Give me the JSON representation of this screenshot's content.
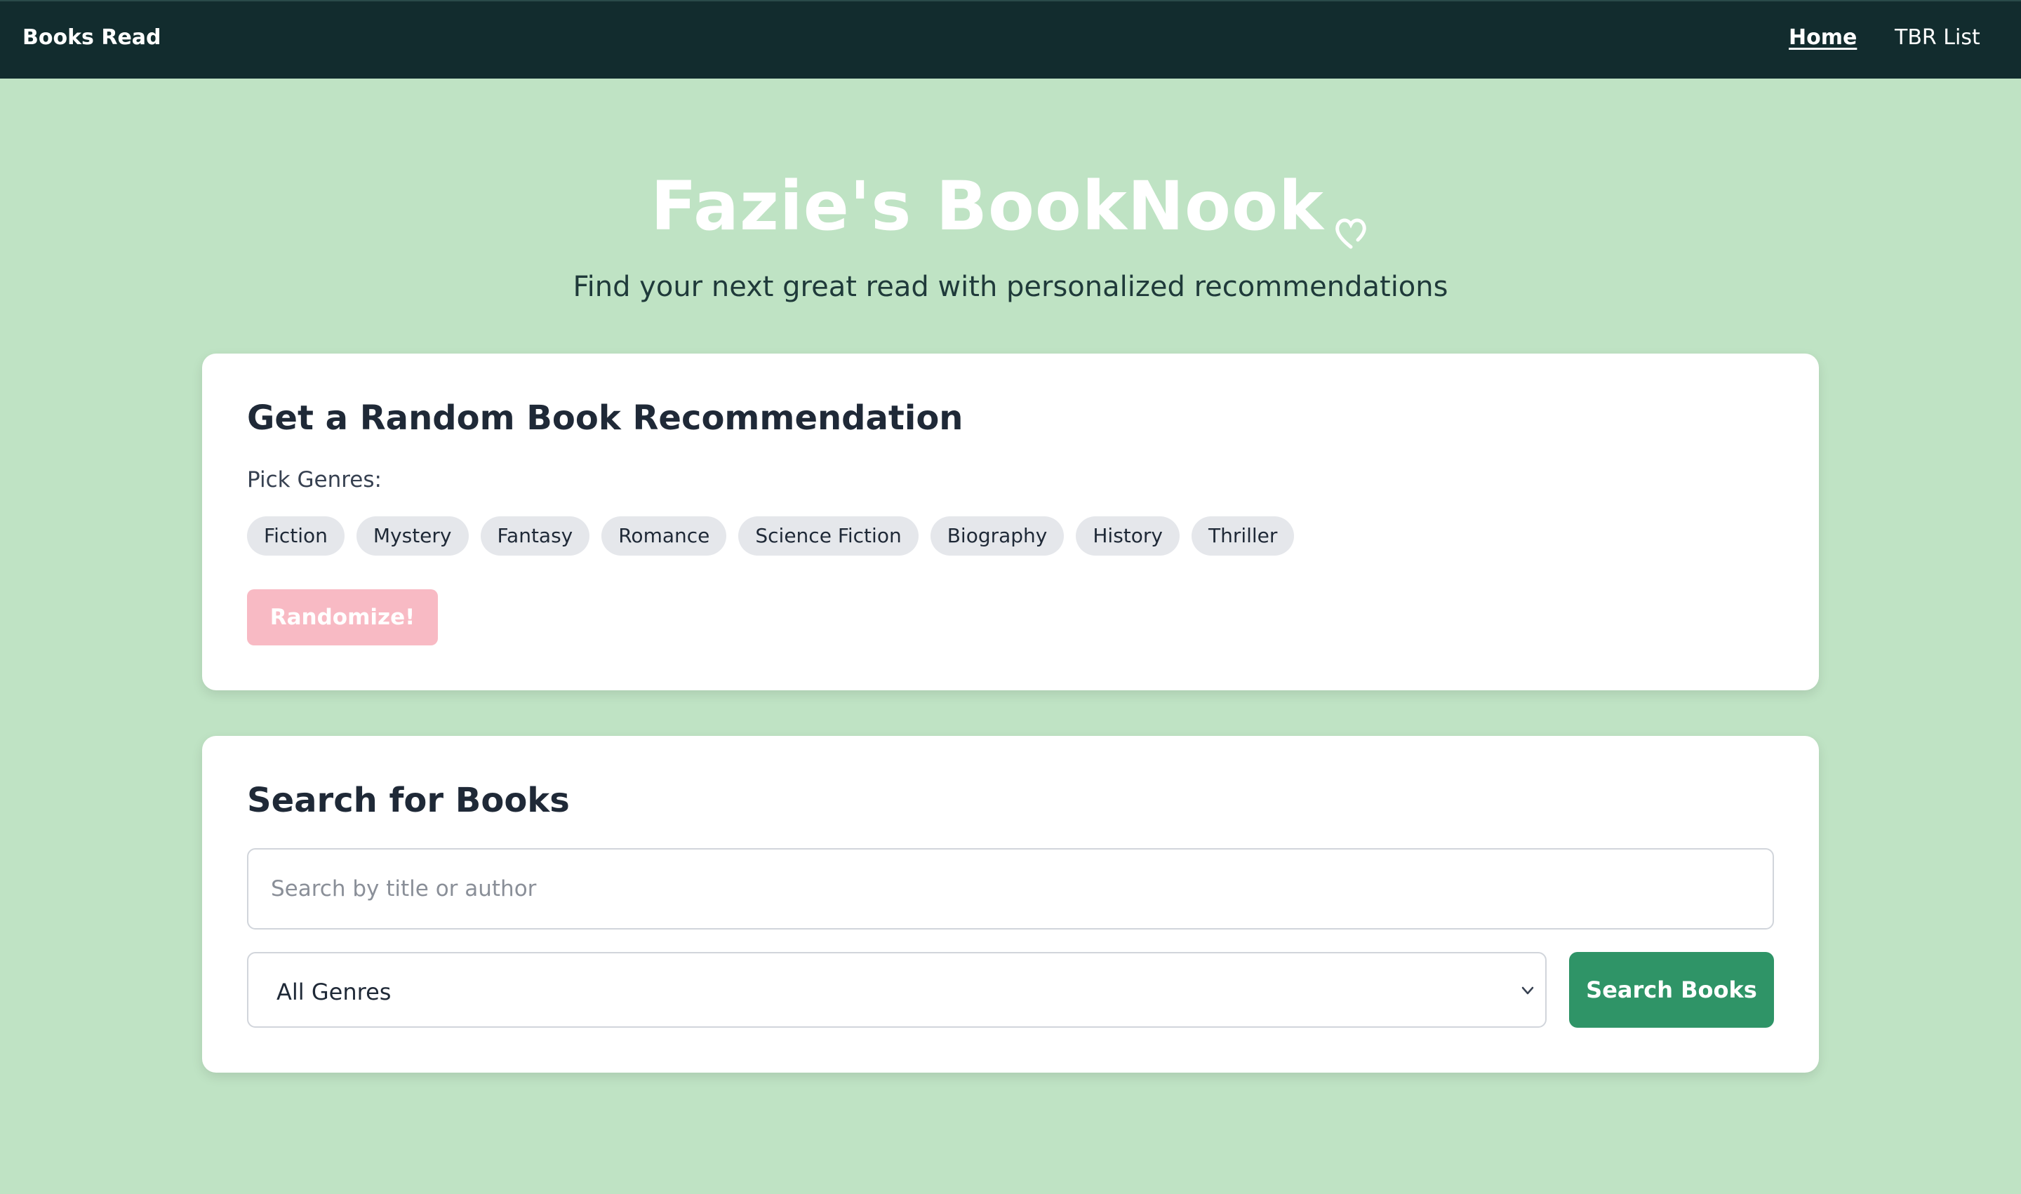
{
  "nav": {
    "brand": "Books Read",
    "links": [
      {
        "label": "Home",
        "active": true
      },
      {
        "label": "TBR List",
        "active": false
      }
    ]
  },
  "hero": {
    "title": "Fazie's BookNook",
    "title_icon": "heart-outline-icon",
    "subtitle": "Find your next great read with personalized recommendations"
  },
  "random": {
    "heading": "Get a Random Book Recommendation",
    "pick_label": "Pick Genres:",
    "genres": [
      "Fiction",
      "Mystery",
      "Fantasy",
      "Romance",
      "Science Fiction",
      "Biography",
      "History",
      "Thriller"
    ],
    "button_label": "Randomize!"
  },
  "search": {
    "heading": "Search for Books",
    "input_placeholder": "Search by title or author",
    "input_value": "",
    "genre_select_value": "All Genres",
    "button_label": "Search Books"
  },
  "colors": {
    "page_bg": "#bfe3c4",
    "nav_bg": "#122c2e",
    "randomize_btn": "#f8bac4",
    "search_btn": "#2f9467",
    "chip_bg": "#e5e7eb"
  }
}
